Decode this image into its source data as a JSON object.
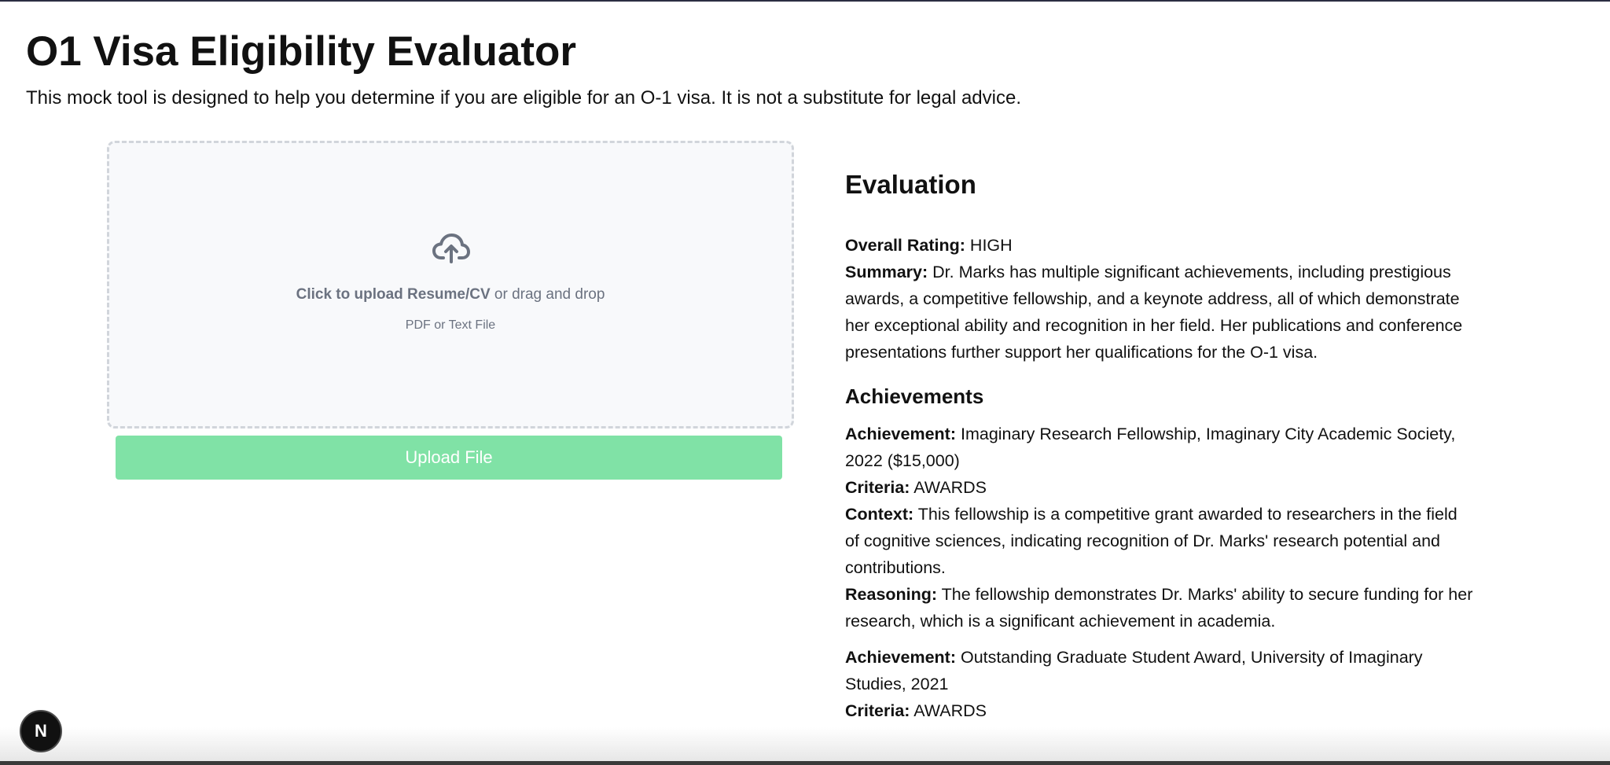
{
  "header": {
    "title": "O1 Visa Eligibility Evaluator",
    "subtitle": "This mock tool is designed to help you determine if you are eligible for an O-1 visa. It is not a substitute for legal advice."
  },
  "upload": {
    "icon": "cloud-upload-icon",
    "click_text": "Click to upload Resume/CV",
    "drag_text": " or drag and drop",
    "hint": "PDF or Text File",
    "button_label": "Upload File",
    "button_color": "#80e2a6"
  },
  "evaluation": {
    "heading": "Evaluation",
    "rating_label": "Overall Rating:",
    "rating_value": " HIGH",
    "summary_label": "Summary:",
    "summary_value": " Dr. Marks has multiple significant achievements, including prestigious awards, a competitive fellowship, and a keynote address, all of which demonstrate her exceptional ability and recognition in her field. Her publications and conference presentations further support her qualifications for the O-1 visa.",
    "achievements_heading": "Achievements",
    "labels": {
      "achievement": "Achievement:",
      "criteria": "Criteria:",
      "context": "Context:",
      "reasoning": "Reasoning:"
    },
    "achievements": [
      {
        "achievement": " Imaginary Research Fellowship, Imaginary City Academic Society, 2022 ($15,000)",
        "criteria": " AWARDS",
        "context": " This fellowship is a competitive grant awarded to researchers in the field of cognitive sciences, indicating recognition of Dr. Marks' research potential and contributions.",
        "reasoning": " The fellowship demonstrates Dr. Marks' ability to secure funding for her research, which is a significant achievement in academia."
      },
      {
        "achievement": " Outstanding Graduate Student Award, University of Imaginary Studies, 2021",
        "criteria": " AWARDS"
      }
    ]
  },
  "dev_badge": {
    "letter": "N",
    "icon": "nextjs-logo-icon"
  }
}
